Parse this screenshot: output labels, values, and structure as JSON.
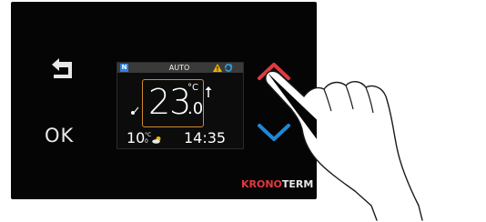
{
  "controls": {
    "ok_label": "OK"
  },
  "display": {
    "status_badge": "N",
    "mode": "AUTO",
    "temperature_integer": "23",
    "temperature_unit": "°C",
    "temperature_decimal": ".0",
    "outdoor_value": "10",
    "outdoor_unit": "°C",
    "outdoor_decimal": "0",
    "time": "14:35"
  },
  "brand": {
    "part1": "KRONO",
    "part2": "TERM"
  },
  "icons": {
    "back": "back-arrow-icon",
    "up": "chevron-up-icon",
    "down": "chevron-down-icon",
    "warning": "warning-icon",
    "sync": "sync-icon",
    "trend": "up-arrow-icon",
    "weather": "partly-cloudy-icon",
    "mode": "heating-mode-icon"
  },
  "colors": {
    "up_accent": "#e03a3e",
    "down_accent": "#1e88d6",
    "temp_frame": "#d28a2c",
    "brand_red": "#e03a3e",
    "badge_blue": "#2f7fe0",
    "warning_yellow": "#f0b400"
  }
}
